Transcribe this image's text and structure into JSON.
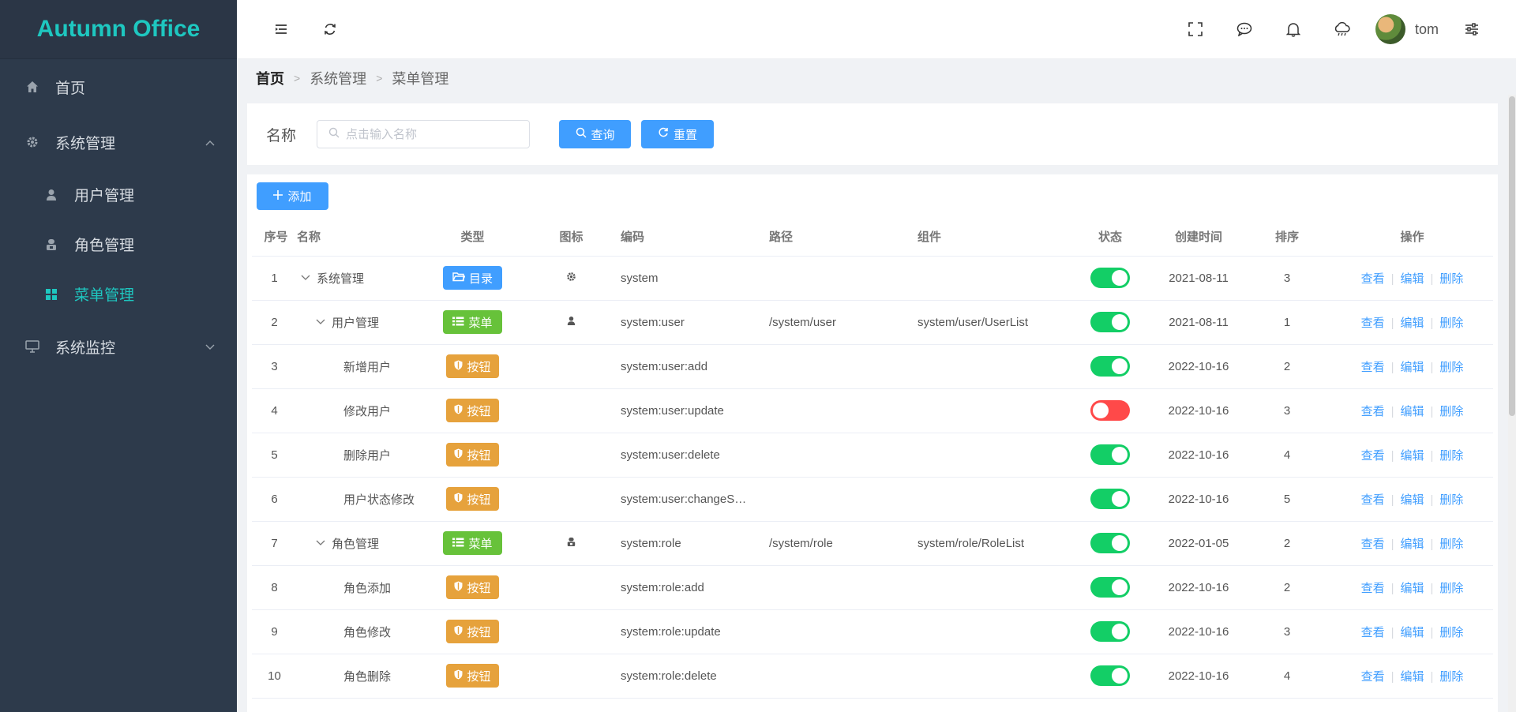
{
  "app": {
    "title": "Autumn Office"
  },
  "sidebar": {
    "items": [
      {
        "label": "首页"
      },
      {
        "label": "系统管理"
      },
      {
        "label": "用户管理"
      },
      {
        "label": "角色管理"
      },
      {
        "label": "菜单管理"
      },
      {
        "label": "系统监控"
      }
    ]
  },
  "header": {
    "username": "tom"
  },
  "breadcrumb": [
    "首页",
    "系统管理",
    "菜单管理"
  ],
  "search": {
    "label": "名称",
    "placeholder": "点击输入名称",
    "query_label": "查询",
    "reset_label": "重置"
  },
  "toolbar": {
    "add_label": "添加"
  },
  "table": {
    "headers": [
      "序号",
      "名称",
      "类型",
      "图标",
      "编码",
      "路径",
      "组件",
      "状态",
      "创建时间",
      "排序",
      "操作"
    ],
    "actions": {
      "view": "查看",
      "edit": "编辑",
      "delete": "删除"
    },
    "rows": [
      {
        "index": "1",
        "name": "系统管理",
        "type": "目录",
        "code": "system",
        "path": "",
        "component": "",
        "date": "2021-08-11",
        "order": "3"
      },
      {
        "index": "2",
        "name": "用户管理",
        "type": "菜单",
        "code": "system:user",
        "path": "/system/user",
        "component": "system/user/UserList",
        "date": "2021-08-11",
        "order": "1"
      },
      {
        "index": "3",
        "name": "新增用户",
        "type": "按钮",
        "code": "system:user:add",
        "path": "",
        "component": "",
        "date": "2022-10-16",
        "order": "2"
      },
      {
        "index": "4",
        "name": "修改用户",
        "type": "按钮",
        "code": "system:user:update",
        "path": "",
        "component": "",
        "date": "2022-10-16",
        "order": "3"
      },
      {
        "index": "5",
        "name": "删除用户",
        "type": "按钮",
        "code": "system:user:delete",
        "path": "",
        "component": "",
        "date": "2022-10-16",
        "order": "4"
      },
      {
        "index": "6",
        "name": "用户状态修改",
        "type": "按钮",
        "code": "system:user:changeS…",
        "path": "",
        "component": "",
        "date": "2022-10-16",
        "order": "5"
      },
      {
        "index": "7",
        "name": "角色管理",
        "type": "菜单",
        "code": "system:role",
        "path": "/system/role",
        "component": "system/role/RoleList",
        "date": "2022-01-05",
        "order": "2"
      },
      {
        "index": "8",
        "name": "角色添加",
        "type": "按钮",
        "code": "system:role:add",
        "path": "",
        "component": "",
        "date": "2022-10-16",
        "order": "2"
      },
      {
        "index": "9",
        "name": "角色修改",
        "type": "按钮",
        "code": "system:role:update",
        "path": "",
        "component": "",
        "date": "2022-10-16",
        "order": "3"
      },
      {
        "index": "10",
        "name": "角色删除",
        "type": "按钮",
        "code": "system:role:delete",
        "path": "",
        "component": "",
        "date": "2022-10-16",
        "order": "4"
      }
    ]
  },
  "colors": {
    "brand": "#1ec7c0",
    "sidebar_bg": "#2d3a4b",
    "primary": "#409eff",
    "success": "#67c23a",
    "warning": "#e6a23c",
    "switch_on": "#13ce66",
    "switch_off": "#ff4949"
  },
  "icons": [
    "home-icon",
    "gear-icon",
    "user-icon",
    "role-icon",
    "menu-grid-icon",
    "monitor-icon",
    "collapse-icon",
    "refresh-icon",
    "fullscreen-icon",
    "message-icon",
    "bell-icon",
    "cloud-icon",
    "settings-icon",
    "search-icon",
    "plus-icon",
    "folder-icon",
    "list-icon",
    "shield-icon"
  ]
}
